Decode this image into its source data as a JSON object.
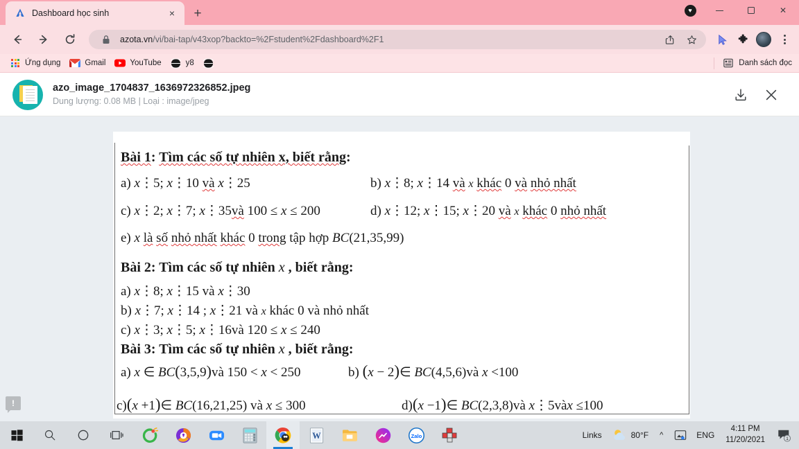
{
  "browser": {
    "tab": {
      "title": "Dashboard học sinh",
      "favicon": "azota-logo-icon",
      "close": "×"
    },
    "newtab_label": "+",
    "window": {
      "heart": "♥",
      "minimize": "—",
      "maximize": "□",
      "close": "✕"
    },
    "toolbar": {
      "back": "←",
      "forward": "→",
      "reload": "⟳",
      "lock": "lock-icon",
      "url_domain": "azota.vn",
      "url_path": "/vi/bai-tap/v43xop?backto=%2Fstudent%2Fdashboard%2F1",
      "share": "share-icon",
      "bookmark": "☆",
      "cursor": "cursor-icon",
      "extensions": "puzzle-icon",
      "profile": "avatar",
      "menu": "kebab-icon"
    },
    "bookmarks": [
      {
        "label": "Ứng dụng",
        "icon": "apps-grid-icon"
      },
      {
        "label": "Gmail",
        "icon": "gmail-icon"
      },
      {
        "label": "YouTube",
        "icon": "youtube-icon"
      },
      {
        "label": "y8",
        "icon": "globe-icon"
      },
      {
        "label": "",
        "icon": "globe-icon"
      }
    ],
    "reading_list": {
      "label": "Danh sách đọc",
      "icon": "reading-list-icon"
    }
  },
  "file_header": {
    "name": "azo_image_1704837_1636972326852.jpeg",
    "subtitle": "Dung lượng: 0.08 MB | Loại : image/jpeg",
    "download_icon": "download-icon",
    "close_icon": "close-icon",
    "thumb_icon": "image-file-icon"
  },
  "document": {
    "bai1": {
      "heading": "Bài 1: Tìm các số tự nhiên x, biết rằng:",
      "a": "a) x⋮5; x⋮10 và x⋮25",
      "b": "b) x⋮8; x⋮14 và x khác 0 và nhỏ nhất",
      "c": "c) x⋮2; x⋮7; x⋮35và 100 ≤ x ≤ 200",
      "d": "d) x⋮12; x⋮15; x⋮20 và x khác 0 nhỏ nhất",
      "e": "e) x là số nhỏ nhất khác 0 trong tập hợp BC(21,35,99)"
    },
    "bai2": {
      "heading": "Bài 2: Tìm các số tự nhiên x , biết rằng:",
      "a": "a) x⋮8; x⋮15 và x⋮30",
      "b": "b) x⋮7; x⋮14 ; x⋮21 và x khác 0 và nhỏ nhất",
      "c": "c) x⋮3; x⋮5; x⋮16và 120 ≤ x ≤ 240"
    },
    "bai3": {
      "heading": "Bài 3: Tìm các số tự nhiên x , biết rằng:",
      "a": "a) x ∈ BC(3,5,9)và 150 < x < 250",
      "b": "b) (x−2) ∈ BC(4,5,6)và x <100",
      "c": "c)(x +1) ∈ BC(16,21,25) và x ≤ 300",
      "d": "d)(x −1) ∈ BC(2,3,8)và x⋮5vàx ≤100"
    },
    "feedback_badge": "!"
  },
  "taskbar": {
    "items": [
      {
        "name": "start-button",
        "icon": "windows-icon"
      },
      {
        "name": "search-button",
        "icon": "search-icon"
      },
      {
        "name": "cortana-button",
        "icon": "circle-icon"
      },
      {
        "name": "task-view-button",
        "icon": "task-view-icon"
      },
      {
        "name": "app-coccoc",
        "icon": "coccoc-icon"
      },
      {
        "name": "app-browser-purple",
        "icon": "avast-browser-icon"
      },
      {
        "name": "app-zoom",
        "icon": "zoom-icon"
      },
      {
        "name": "app-calculator",
        "icon": "calculator-icon"
      },
      {
        "name": "app-chrome",
        "icon": "chrome-icon"
      },
      {
        "name": "app-word",
        "icon": "word-icon"
      },
      {
        "name": "app-file-explorer",
        "icon": "folder-icon"
      },
      {
        "name": "app-messenger",
        "icon": "messenger-icon"
      },
      {
        "name": "app-zalo",
        "icon": "zalo-icon"
      },
      {
        "name": "app-unikey",
        "icon": "unikey-icon"
      }
    ],
    "links_label": "Links",
    "weather": {
      "icon": "sun-cloud-icon",
      "temp": "80°F"
    },
    "tray_expand": "^",
    "tray_icons": [
      "onedrive-icon"
    ],
    "language": "ENG",
    "time": "4:11 PM",
    "date": "11/20/2021",
    "notifications": {
      "icon": "notification-icon",
      "count": "1"
    }
  },
  "colors": {
    "tabstrip": "#f9a8b4",
    "toolbar": "#fbdfe3",
    "bookmarks": "#fde3e6",
    "omnibox": "#e8d2d6",
    "viewer_bg": "#eaeef2",
    "paper": "#ffffff",
    "taskbar": "#d8dce0",
    "accent_blue": "#1b7fd4",
    "teal": "#17b3ae"
  }
}
